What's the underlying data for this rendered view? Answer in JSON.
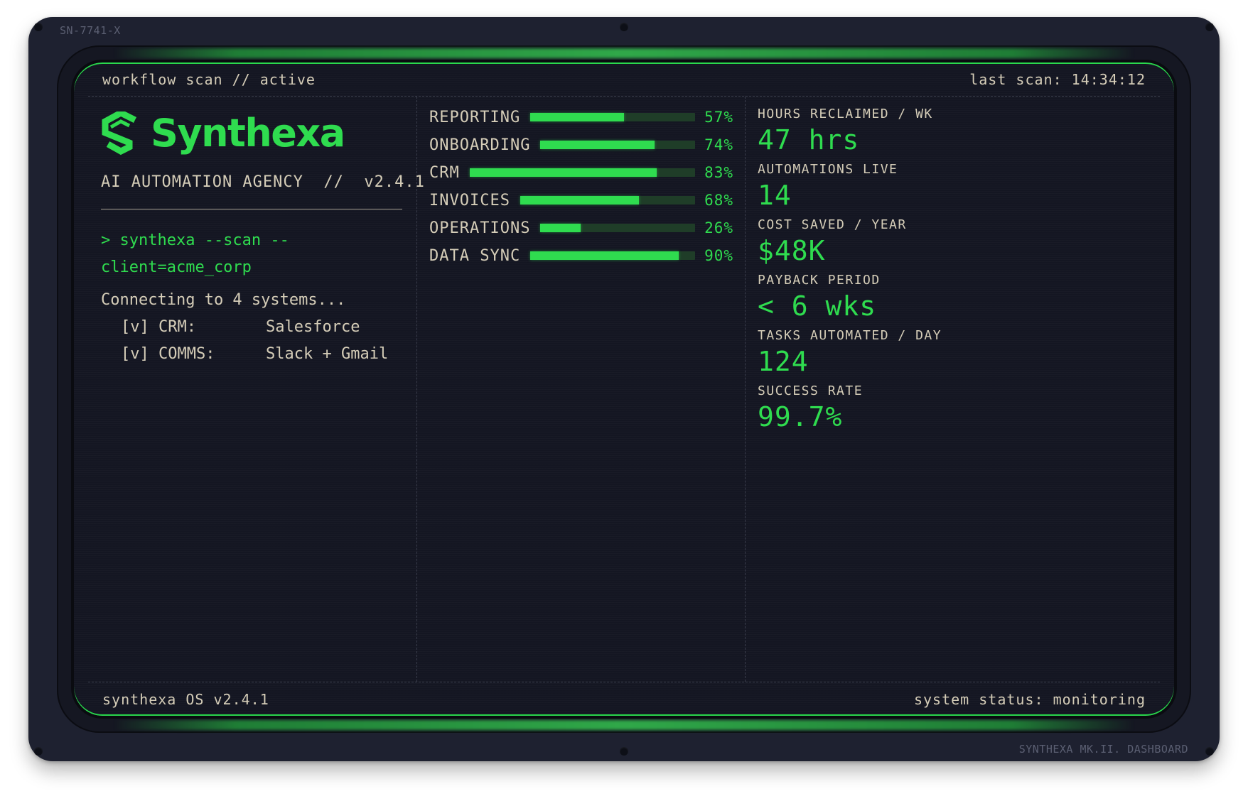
{
  "device": {
    "serial": "SN-7741-X",
    "model": "SYNTHEXA MK.II. DASHBOARD"
  },
  "topbar": {
    "left": "workflow scan // active",
    "right": "last scan: 14:34:12"
  },
  "brand": {
    "name": "Synthexa",
    "subtitle": "AI AUTOMATION AGENCY  //  v2.4.1",
    "accent": "#2fdc4f",
    "logo_icon": "synthexa-s-logo"
  },
  "terminal": {
    "command": "> synthexa --scan --client=acme_corp",
    "connecting": "Connecting to 4 systems...",
    "systems": [
      {
        "key": "[v] CRM:",
        "value": "Salesforce"
      },
      {
        "key": "[v] COMMS:",
        "value": "Slack + Gmail"
      }
    ]
  },
  "progress": [
    {
      "label": "REPORTING",
      "value": 57,
      "display": "57%"
    },
    {
      "label": "ONBOARDING",
      "value": 74,
      "display": "74%"
    },
    {
      "label": "CRM",
      "value": 83,
      "display": "83%"
    },
    {
      "label": "INVOICES",
      "value": 68,
      "display": "68%"
    },
    {
      "label": "OPERATIONS",
      "value": 26,
      "display": "26%"
    },
    {
      "label": "DATA SYNC",
      "value": 90,
      "display": "90%"
    }
  ],
  "metrics": [
    {
      "label": "HOURS RECLAIMED / WK",
      "value": "47 hrs"
    },
    {
      "label": "AUTOMATIONS LIVE",
      "value": "14"
    },
    {
      "label": "COST SAVED / YEAR",
      "value": "$48K"
    },
    {
      "label": "PAYBACK PERIOD",
      "value": "< 6 wks"
    },
    {
      "label": "TASKS AUTOMATED / DAY",
      "value": "124"
    },
    {
      "label": "SUCCESS RATE",
      "value": "99.7%"
    }
  ],
  "botbar": {
    "left": "synthexa OS v2.4.1",
    "right": "system status: monitoring"
  }
}
